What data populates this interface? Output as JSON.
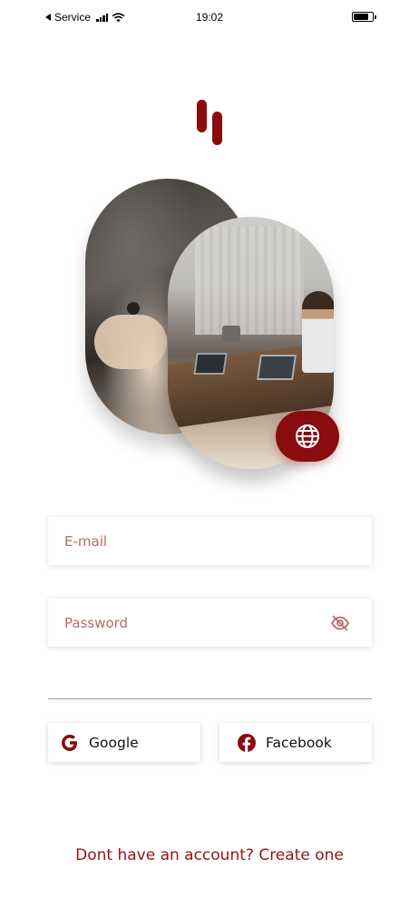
{
  "status_bar": {
    "carrier": "Service",
    "time": "19:02"
  },
  "colors": {
    "brand": "#8a0c0e",
    "link": "#9b1114",
    "placeholder": "#b96a6c"
  },
  "hero": {
    "action_icon": "globe-icon"
  },
  "form": {
    "email_placeholder": "E-mail",
    "password_placeholder": "Password",
    "password_visibility_icon": "eye-slash-icon"
  },
  "social": {
    "google_label": "Google",
    "facebook_label": "Facebook"
  },
  "footer": {
    "signup_text": "Dont have an account? Create one"
  }
}
